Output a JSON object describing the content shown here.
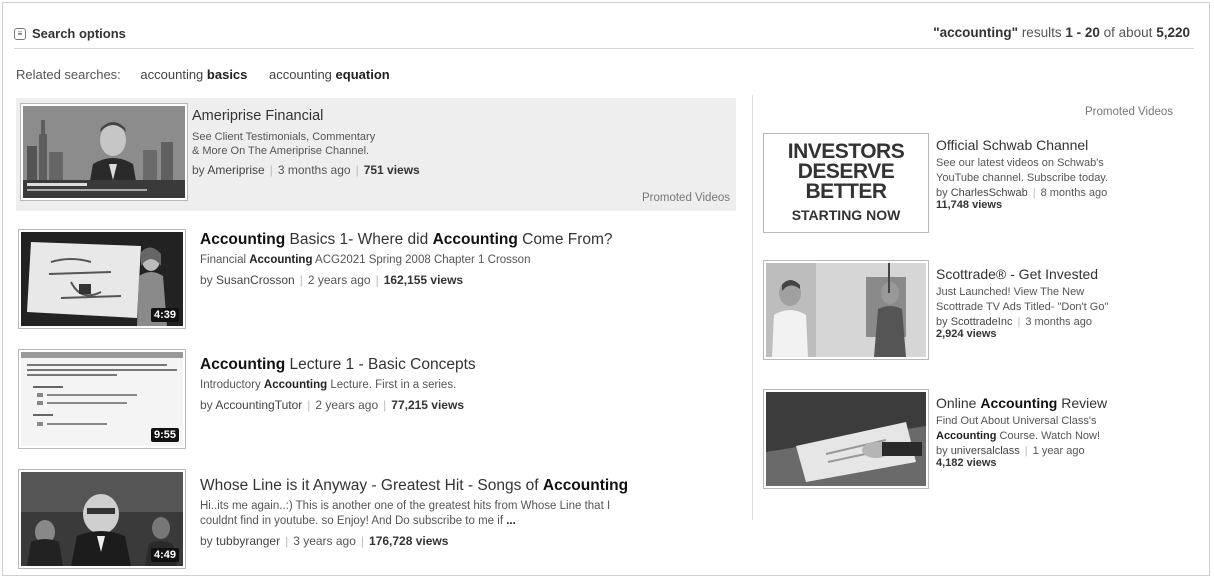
{
  "search": {
    "options_label": "Search options",
    "query": "\"accounting\"",
    "results_word": "results",
    "range": "1 - 20",
    "of_about": "of about",
    "total": "5,220"
  },
  "related": {
    "label": "Related searches:",
    "items": [
      {
        "plain": "accounting",
        "bold": "basics"
      },
      {
        "plain": "accounting",
        "bold": "equation"
      }
    ]
  },
  "promoted_top": {
    "title": "Ameriprise Financial",
    "desc1": "See Client Testimonials, Commentary",
    "desc2": "& More On The Ameriprise Channel.",
    "by": "by",
    "author": "Ameriprise",
    "age": "3 months ago",
    "views": "751 views",
    "label": "Promoted Videos"
  },
  "results": [
    {
      "title_parts": [
        [
          "b",
          "Accounting"
        ],
        [
          "t",
          " Basics 1- Where did "
        ],
        [
          "b",
          "Accounting"
        ],
        [
          "t",
          " Come From?"
        ]
      ],
      "desc_parts": [
        [
          "t",
          "Financial "
        ],
        [
          "b",
          "Accounting"
        ],
        [
          "t",
          " ACG2021 Spring 2008 Chapter 1 Crosson"
        ]
      ],
      "author": "SusanCrosson",
      "age": "2 years ago",
      "views": "162,155 views",
      "duration": "4:39"
    },
    {
      "title_parts": [
        [
          "b",
          "Accounting"
        ],
        [
          "t",
          " Lecture 1 - Basic Concepts"
        ]
      ],
      "desc_parts": [
        [
          "t",
          "Introductory "
        ],
        [
          "b",
          "Accounting"
        ],
        [
          "t",
          " Lecture. First in a series."
        ]
      ],
      "author": "AccountingTutor",
      "age": "2 years ago",
      "views": "77,215 views",
      "duration": "9:55"
    },
    {
      "title_parts": [
        [
          "t",
          "Whose Line is it Anyway - Greatest Hit - Songs of "
        ],
        [
          "b",
          "Accounting"
        ]
      ],
      "desc_parts": [
        [
          "t",
          "Hi..its me again..:) This is another one of the greatest hits from Whose Line that I"
        ]
      ],
      "desc2_parts": [
        [
          "t",
          "couldnt find in youtube. so Enjoy! And Do subscribe to me if "
        ],
        [
          "b",
          "..."
        ]
      ],
      "author": "tubbyranger",
      "age": "3 years ago",
      "views": "176,728 views",
      "duration": "4:49"
    }
  ],
  "sidebar": {
    "heading": "Promoted Videos",
    "schwab_thumb": {
      "line1": "INVESTORS",
      "line2": "DESERVE",
      "line3": "BETTER",
      "line4": "STARTING NOW"
    },
    "items": [
      {
        "title_parts": [
          [
            "t",
            "Official Schwab Channel"
          ]
        ],
        "desc1_parts": [
          [
            "t",
            "See our latest videos on Schwab's"
          ]
        ],
        "desc2_parts": [
          [
            "t",
            "YouTube channel. Subscribe today."
          ]
        ],
        "author": "CharlesSchwab",
        "age": "8 months ago",
        "views": "11,748 views"
      },
      {
        "title_parts": [
          [
            "t",
            "Scottrade® - Get Invested"
          ]
        ],
        "desc1_parts": [
          [
            "t",
            "Just Launched! View The New"
          ]
        ],
        "desc2_parts": [
          [
            "t",
            "Scottrade TV Ads Titled- \"Don't Go\""
          ]
        ],
        "author": "ScottradeInc",
        "age": "3 months ago",
        "views": "2,924 views"
      },
      {
        "title_parts": [
          [
            "t",
            "Online "
          ],
          [
            "b",
            "Accounting"
          ],
          [
            "t",
            " Review"
          ]
        ],
        "desc1_parts": [
          [
            "t",
            "Find Out About Universal Class's"
          ]
        ],
        "desc2_parts": [
          [
            "b",
            "Accounting"
          ],
          [
            "t",
            " Course. Watch Now!"
          ]
        ],
        "author": "universalclass",
        "age": "1 year ago",
        "views": "4,182 views"
      }
    ]
  }
}
